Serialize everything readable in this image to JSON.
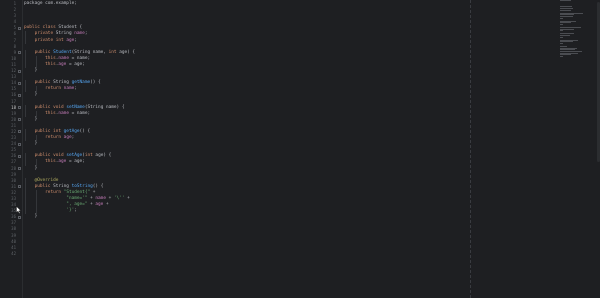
{
  "editor": {
    "lines": [
      {
        "n": "1",
        "parts": [
          {
            "c": "plain",
            "t": "package "
          },
          {
            "c": "plain",
            "t": "com.example"
          },
          {
            "c": "plain",
            "t": ";"
          }
        ]
      },
      {
        "n": "2",
        "parts": []
      },
      {
        "n": "3",
        "parts": []
      },
      {
        "n": "4",
        "parts": []
      },
      {
        "n": "5",
        "parts": [
          {
            "c": "kw",
            "t": "public class "
          },
          {
            "c": "plain",
            "t": "Student {"
          }
        ]
      },
      {
        "n": "6",
        "parts": [
          {
            "c": "plain",
            "t": "    "
          },
          {
            "c": "kw",
            "t": "private "
          },
          {
            "c": "plain",
            "t": "String "
          },
          {
            "c": "field",
            "t": "name"
          },
          {
            "c": "plain",
            "t": ";"
          }
        ]
      },
      {
        "n": "7",
        "parts": [
          {
            "c": "plain",
            "t": "    "
          },
          {
            "c": "kw",
            "t": "private int "
          },
          {
            "c": "field",
            "t": "age"
          },
          {
            "c": "plain",
            "t": ";"
          }
        ]
      },
      {
        "n": "8",
        "parts": []
      },
      {
        "n": "9",
        "parts": [
          {
            "c": "plain",
            "t": "    "
          },
          {
            "c": "kw",
            "t": "public "
          },
          {
            "c": "fn",
            "t": "Student"
          },
          {
            "c": "plain",
            "t": "(String name, "
          },
          {
            "c": "kw",
            "t": "int "
          },
          {
            "c": "plain",
            "t": "age) {"
          }
        ]
      },
      {
        "n": "10",
        "parts": [
          {
            "c": "plain",
            "t": "        "
          },
          {
            "c": "kw",
            "t": "this"
          },
          {
            "c": "plain",
            "t": "."
          },
          {
            "c": "field",
            "t": "name"
          },
          {
            "c": "plain",
            "t": " = name;"
          }
        ]
      },
      {
        "n": "11",
        "parts": [
          {
            "c": "plain",
            "t": "        "
          },
          {
            "c": "kw",
            "t": "this"
          },
          {
            "c": "plain",
            "t": "."
          },
          {
            "c": "field",
            "t": "age"
          },
          {
            "c": "plain",
            "t": " = age;"
          }
        ]
      },
      {
        "n": "12",
        "parts": [
          {
            "c": "plain",
            "t": "    }"
          }
        ]
      },
      {
        "n": "13",
        "parts": []
      },
      {
        "n": "14",
        "parts": [
          {
            "c": "plain",
            "t": "    "
          },
          {
            "c": "kw",
            "t": "public "
          },
          {
            "c": "plain",
            "t": "String "
          },
          {
            "c": "fn",
            "t": "getName"
          },
          {
            "c": "plain",
            "t": "() {"
          }
        ]
      },
      {
        "n": "15",
        "parts": [
          {
            "c": "plain",
            "t": "        "
          },
          {
            "c": "kw",
            "t": "return "
          },
          {
            "c": "field",
            "t": "name"
          },
          {
            "c": "plain",
            "t": ";"
          }
        ]
      },
      {
        "n": "16",
        "parts": [
          {
            "c": "plain",
            "t": "    }"
          }
        ]
      },
      {
        "n": "17",
        "parts": []
      },
      {
        "n": "18",
        "parts": [
          {
            "c": "plain",
            "t": "    "
          },
          {
            "c": "kw",
            "t": "public void "
          },
          {
            "c": "fn",
            "t": "setName"
          },
          {
            "c": "plain",
            "t": "(String name) {"
          }
        ]
      },
      {
        "n": "19",
        "parts": [
          {
            "c": "plain",
            "t": "        "
          },
          {
            "c": "kw",
            "t": "this"
          },
          {
            "c": "plain",
            "t": "."
          },
          {
            "c": "field",
            "t": "name"
          },
          {
            "c": "plain",
            "t": " = name;"
          }
        ]
      },
      {
        "n": "20",
        "parts": [
          {
            "c": "plain",
            "t": "    }"
          }
        ]
      },
      {
        "n": "21",
        "parts": []
      },
      {
        "n": "22",
        "parts": [
          {
            "c": "plain",
            "t": "    "
          },
          {
            "c": "kw",
            "t": "public int "
          },
          {
            "c": "fn",
            "t": "getAge"
          },
          {
            "c": "plain",
            "t": "() {"
          }
        ]
      },
      {
        "n": "23",
        "parts": [
          {
            "c": "plain",
            "t": "        "
          },
          {
            "c": "kw",
            "t": "return "
          },
          {
            "c": "field",
            "t": "age"
          },
          {
            "c": "plain",
            "t": ";"
          }
        ]
      },
      {
        "n": "24",
        "parts": [
          {
            "c": "plain",
            "t": "    }"
          }
        ]
      },
      {
        "n": "25",
        "parts": []
      },
      {
        "n": "26",
        "parts": [
          {
            "c": "plain",
            "t": "    "
          },
          {
            "c": "kw",
            "t": "public void "
          },
          {
            "c": "fn",
            "t": "setAge"
          },
          {
            "c": "plain",
            "t": "("
          },
          {
            "c": "kw",
            "t": "int "
          },
          {
            "c": "plain",
            "t": "age) {"
          }
        ]
      },
      {
        "n": "27",
        "parts": [
          {
            "c": "plain",
            "t": "        "
          },
          {
            "c": "kw",
            "t": "this"
          },
          {
            "c": "plain",
            "t": "."
          },
          {
            "c": "field",
            "t": "age"
          },
          {
            "c": "plain",
            "t": " = age;"
          }
        ]
      },
      {
        "n": "28",
        "parts": [
          {
            "c": "plain",
            "t": "    }"
          }
        ]
      },
      {
        "n": "29",
        "parts": []
      },
      {
        "n": "30",
        "parts": [
          {
            "c": "plain",
            "t": "    "
          },
          {
            "c": "ann",
            "t": "@Override"
          }
        ]
      },
      {
        "n": "31",
        "parts": [
          {
            "c": "plain",
            "t": "    "
          },
          {
            "c": "kw",
            "t": "public "
          },
          {
            "c": "plain",
            "t": "String "
          },
          {
            "c": "fn",
            "t": "toString"
          },
          {
            "c": "plain",
            "t": "() {"
          }
        ]
      },
      {
        "n": "32",
        "parts": [
          {
            "c": "plain",
            "t": "        "
          },
          {
            "c": "kw",
            "t": "return "
          },
          {
            "c": "str",
            "t": "\"Student{\""
          },
          {
            "c": "plain",
            "t": " +"
          }
        ]
      },
      {
        "n": "33",
        "parts": [
          {
            "c": "plain",
            "t": "                "
          },
          {
            "c": "str",
            "t": "\"name='\""
          },
          {
            "c": "plain",
            "t": " + "
          },
          {
            "c": "field",
            "t": "name"
          },
          {
            "c": "plain",
            "t": " + "
          },
          {
            "c": "str",
            "t": "'\\''"
          },
          {
            "c": "plain",
            "t": " +"
          }
        ]
      },
      {
        "n": "34",
        "parts": [
          {
            "c": "plain",
            "t": "                "
          },
          {
            "c": "str",
            "t": "\", age=\""
          },
          {
            "c": "plain",
            "t": " + "
          },
          {
            "c": "field",
            "t": "age"
          },
          {
            "c": "plain",
            "t": " +"
          }
        ]
      },
      {
        "n": "35",
        "parts": [
          {
            "c": "plain",
            "t": "                "
          },
          {
            "c": "str",
            "t": "'}'"
          },
          {
            "c": "plain",
            "t": ";"
          }
        ]
      },
      {
        "n": "36",
        "parts": [
          {
            "c": "plain",
            "t": "    }"
          }
        ]
      },
      {
        "n": "37",
        "parts": []
      },
      {
        "n": "38",
        "parts": []
      },
      {
        "n": "39",
        "parts": []
      },
      {
        "n": "40",
        "parts": []
      },
      {
        "n": "41",
        "parts": []
      },
      {
        "n": "42",
        "parts": []
      }
    ],
    "active_line": "18",
    "fold_lines": [
      "5",
      "9",
      "12",
      "14",
      "16",
      "18",
      "20",
      "22",
      "24",
      "26",
      "28",
      "31",
      "36"
    ]
  },
  "icons": {
    "cursor": "mouse-pointer-icon"
  },
  "colors": {
    "background": "#1e1f22",
    "keyword": "#cf8e6d",
    "method": "#56a8f5",
    "field": "#c77dbb",
    "string": "#6aab73",
    "annotation": "#b3ae60"
  }
}
